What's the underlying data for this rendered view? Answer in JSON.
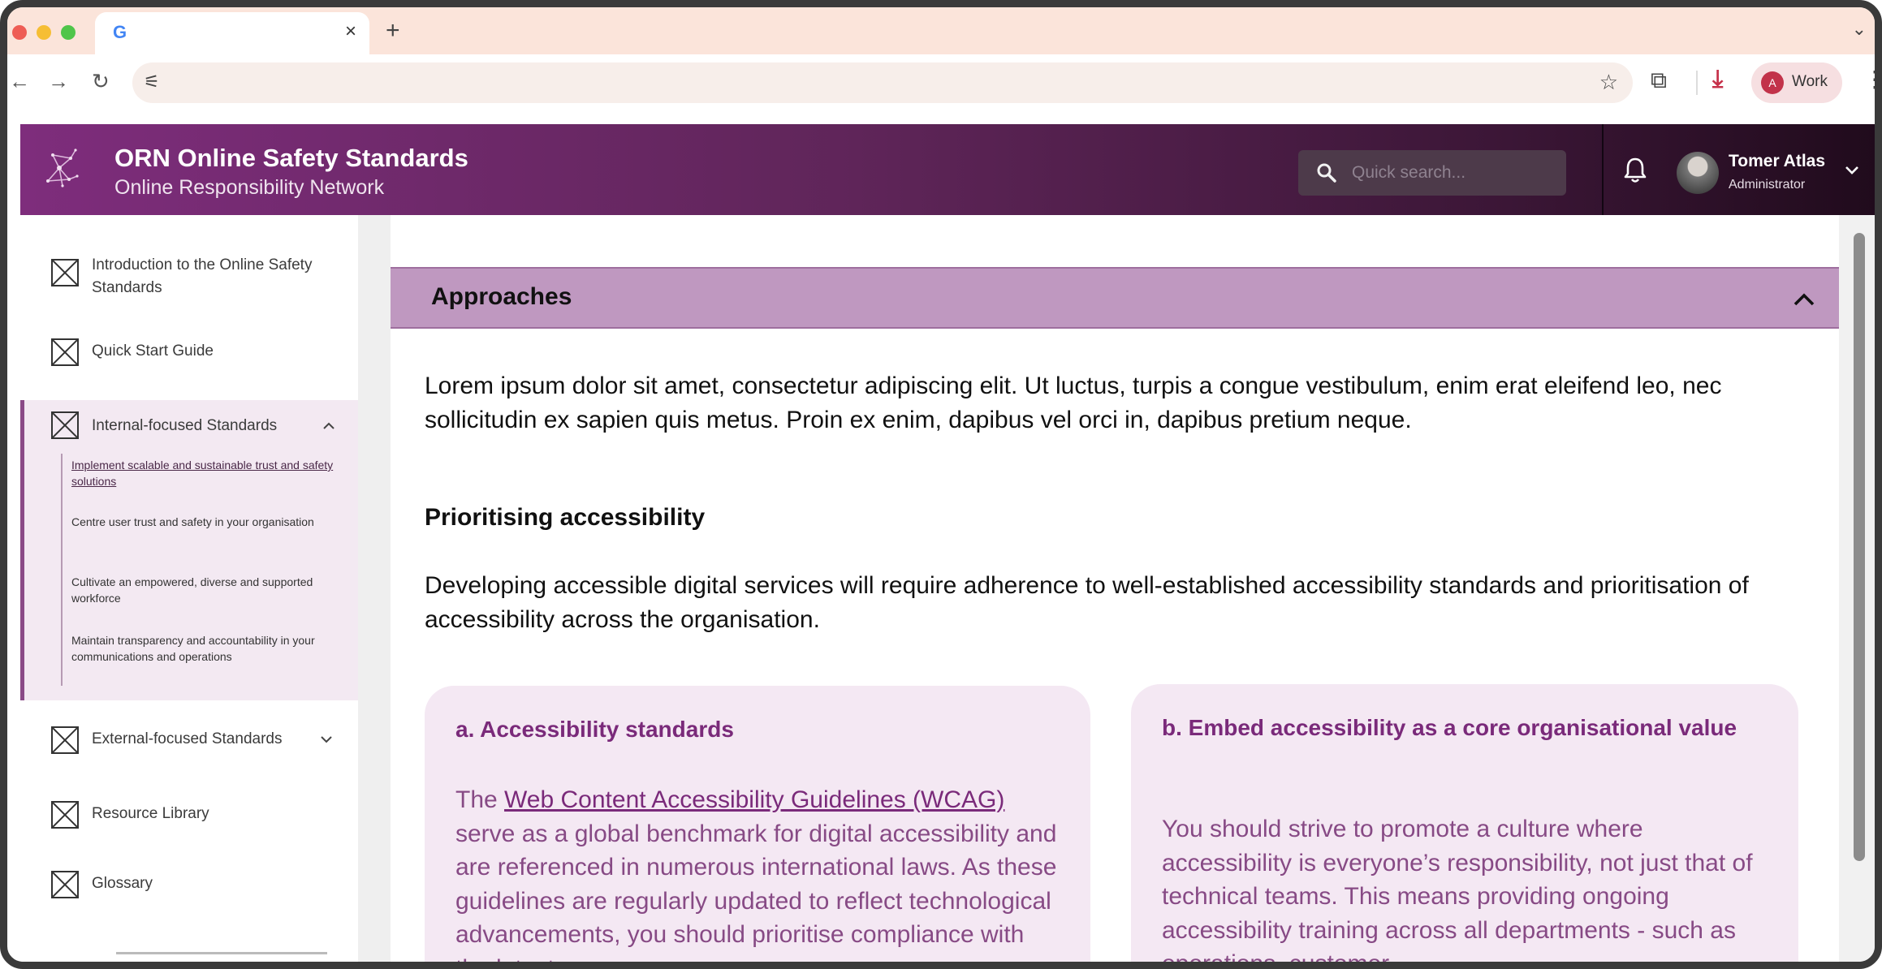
{
  "browser": {
    "tab_favicon": "G",
    "tab_close": "×",
    "new_tab": "+",
    "tab_menu": "⌄",
    "back": "←",
    "forward": "→",
    "reload": "↻",
    "site_info": "⚟",
    "bookmark": "☆",
    "extensions": "⧉",
    "download": "⤓",
    "profile_initial": "A",
    "profile_label": "Work",
    "menu": "⋮"
  },
  "header": {
    "title": "ORN Online Safety Standards",
    "subtitle": "Online Responsibility Network",
    "search_placeholder": "Quick search...",
    "user_name": "Tomer Atlas",
    "user_role": "Administrator",
    "colors": {
      "brand_start": "#7e2d7c",
      "brand_end": "#200b1c"
    }
  },
  "sidebar": {
    "items": [
      {
        "label": "Introduction to the Online Safety Standards"
      },
      {
        "label": "Quick Start Guide"
      },
      {
        "label": "Internal-focused Standards",
        "expanded": true
      },
      {
        "label": "External-focused Standards",
        "expanded": false
      },
      {
        "label": "Resource Library"
      },
      {
        "label": "Glossary"
      }
    ],
    "subitems": [
      "Implement scalable and sustainable trust and safety solutions",
      "Centre user trust and safety in your organisation",
      "Cultivate an empowered, diverse and supported workforce",
      "Maintain transparency and accountability in your communications and operations"
    ],
    "chevron_up": "⌃",
    "chevron_down": "⌄"
  },
  "main": {
    "accordion_title": "Approaches",
    "accordion_toggle": "⌃",
    "intro": "Lorem ipsum dolor sit amet, consectetur adipiscing elit. Ut luctus, turpis a congue vestibulum, enim erat eleifend leo, nec sollicitudin ex sapien quis metus. Proin ex enim, dapibus vel orci in, dapibus pretium neque.",
    "section_heading": "Prioritising accessibility",
    "section_text": "Developing accessible digital services will require adherence to well-established accessibility standards and prioritisation of accessibility across the organisation.",
    "card_a": {
      "title": "a. Accessibility standards",
      "text_prefix": "The ",
      "link": "Web Content Accessibility Guidelines (WCAG)",
      "text_rest": " serve as a global benchmark for digital accessibility and are referenced in numerous international laws. As these guidelines are regularly updated to reflect technological advancements, you should prioritise compliance with the latest"
    },
    "card_b": {
      "title": "b. Embed accessibility as a core organisational value",
      "text": "You should strive to promote a culture where accessibility is everyone’s responsibility, not just that of technical teams. This means providing ongoing accessibility training across all departments - such as operations, customer"
    }
  }
}
